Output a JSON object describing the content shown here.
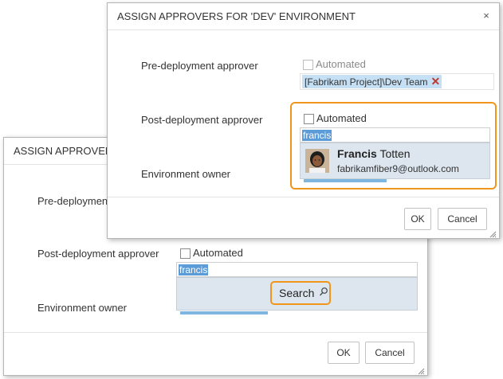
{
  "back_dialog": {
    "title": "ASSIGN APPROVERS F",
    "pre_label": "Pre-deployment",
    "post_label": "Post-deployment approver",
    "owner_label": "Environment owner",
    "automated_label": "Automated",
    "search_text": "francis",
    "search_button": "Search",
    "ok_label": "OK",
    "cancel_label": "Cancel"
  },
  "front_dialog": {
    "title": "ASSIGN APPROVERS FOR 'DEV' ENVIRONMENT",
    "close_glyph": "×",
    "pre_label": "Pre-deployment approver",
    "pre_automated_label": "Automated",
    "pre_tag": "[Fabrikam Project]\\Dev Team",
    "post_label": "Post-deployment approver",
    "post_automated_label": "Automated",
    "search_text": "francis",
    "suggestion_first": "Francis",
    "suggestion_last": " Totten",
    "suggestion_email": "fabrikamfiber9@outlook.com",
    "owner_label": "Environment owner",
    "ok_label": "OK",
    "cancel_label": "Cancel"
  },
  "colors": {
    "highlight": "#f0961d",
    "selection": "#5a9bd8",
    "tag_bg": "#c5e0f5",
    "dropdown_bg": "#dde6ef"
  }
}
